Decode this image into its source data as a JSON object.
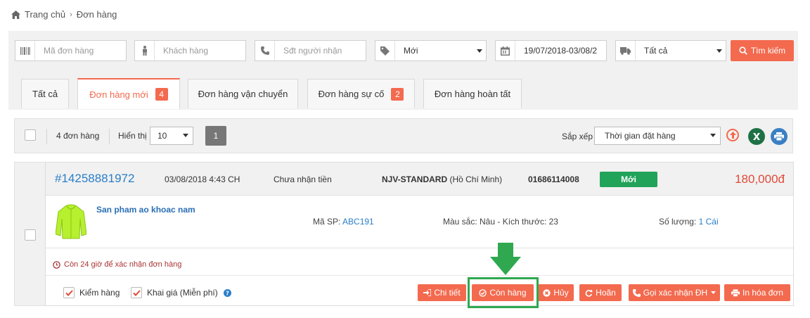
{
  "breadcrumb": {
    "home": "Trang chủ",
    "current": "Đơn hàng"
  },
  "filters": {
    "order_code_placeholder": "Mã đơn hàng",
    "customer_placeholder": "Khách hàng",
    "phone_placeholder": "Sđt người nhận",
    "status_value": "Mới",
    "date_range": "19/07/2018-03/08/2",
    "shipping_value": "Tất cả",
    "search_label": "Tìm kiếm"
  },
  "tabs": [
    {
      "label": "Tất cả"
    },
    {
      "label": "Đơn hàng mới",
      "count": "4"
    },
    {
      "label": "Đơn hàng vận chuyển"
    },
    {
      "label": "Đơn hàng sự cố",
      "count": "2"
    },
    {
      "label": "Đơn hàng hoàn tất"
    }
  ],
  "toolbar": {
    "order_count": "4 đơn hàng",
    "show_label": "Hiển thị",
    "page_size": "10",
    "page": "1",
    "sort_label": "Sắp xếp",
    "sort_value": "Thời gian đặt hàng"
  },
  "order": {
    "id": "#14258881972",
    "datetime": "03/08/2018 4:43 CH",
    "payment": "Chưa nhận tiền",
    "service": "NJV-STANDARD",
    "region": "(Hồ Chí Minh)",
    "phone": "01686114008",
    "status": "Mới",
    "price": "180,000đ",
    "product": {
      "name": "San pham ao khoac nam",
      "sku_label": "Mã SP:",
      "sku": "ABC191",
      "attributes": "Màu sắc: Nâu - Kích thước: 23",
      "qty_label": "Số lượng:",
      "qty": "1 Cái"
    },
    "warning": "Còn 24 giờ để xác nhận đơn hàng",
    "options": {
      "inspect": "Kiểm hàng",
      "declare": "Khai giá (Miễn phí)"
    },
    "actions": {
      "detail": "Chi tiết",
      "in_stock": "Còn hàng",
      "cancel": "Hủy",
      "postpone": "Hoãn",
      "call_confirm": "Gọi xác nhận ĐH",
      "print": "In hóa đơn"
    }
  },
  "colors": {
    "accent": "#f36a4f",
    "status_green": "#21a35a",
    "link_blue": "#2a7ec8",
    "highlight": "#2fa84f"
  }
}
